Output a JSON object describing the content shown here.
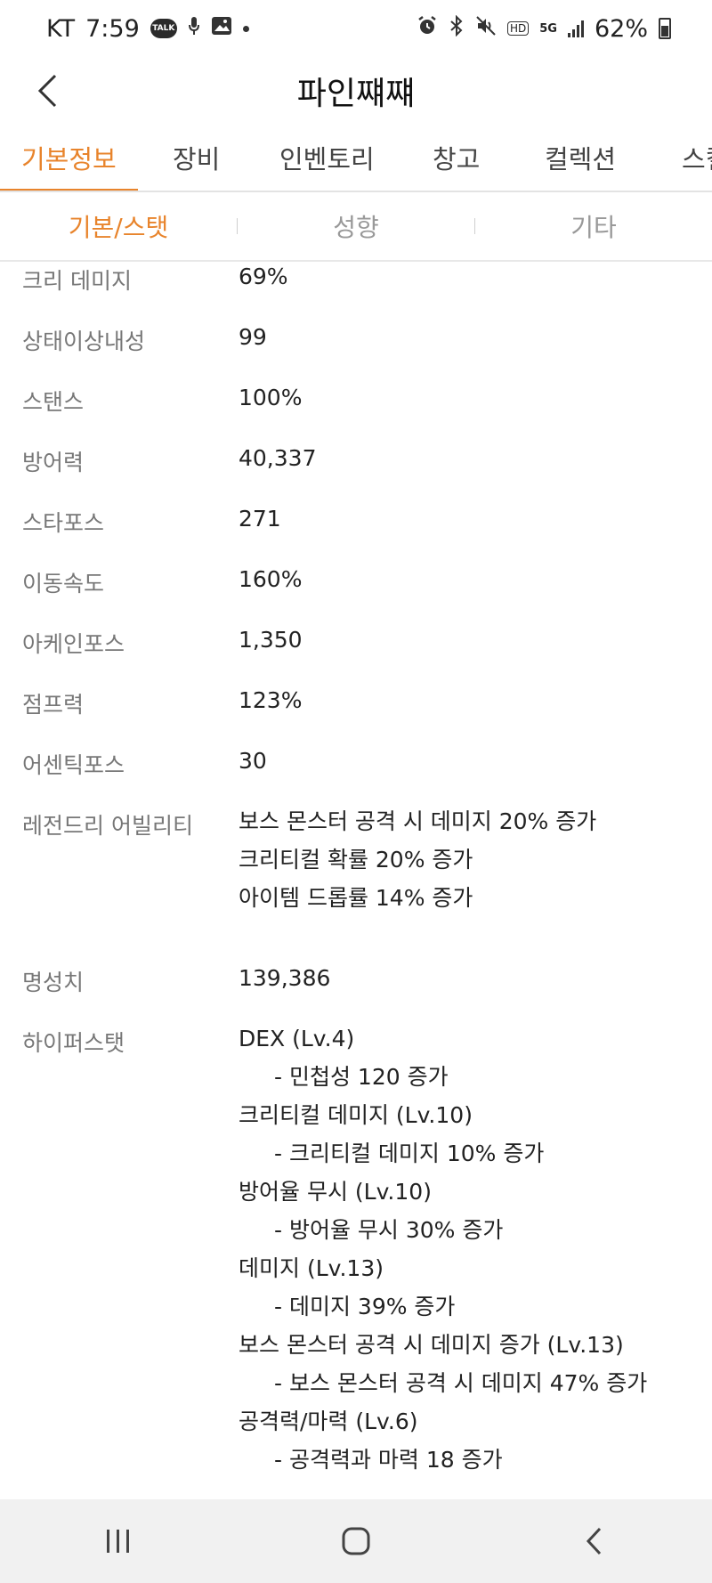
{
  "status_bar": {
    "carrier": "KT",
    "time": "7:59",
    "talk_badge": "TALK",
    "hd": "HD",
    "network": "5G",
    "battery_percent": "62%"
  },
  "header": {
    "title": "파인쨰쨰"
  },
  "tabs": [
    {
      "label": "기본정보",
      "active": true
    },
    {
      "label": "장비",
      "active": false
    },
    {
      "label": "인벤토리",
      "active": false
    },
    {
      "label": "창고",
      "active": false
    },
    {
      "label": "컬렉션",
      "active": false
    },
    {
      "label": "스킬",
      "active": false
    }
  ],
  "subtabs": [
    {
      "label": "기본/스탯",
      "active": true
    },
    {
      "label": "성향",
      "active": false
    },
    {
      "label": "기타",
      "active": false
    }
  ],
  "stats": [
    {
      "label": "크리 데미지",
      "value": "69%"
    },
    {
      "label": "상태이상내성",
      "value": "99"
    },
    {
      "label": "스탠스",
      "value": "100%"
    },
    {
      "label": "방어력",
      "value": "40,337"
    },
    {
      "label": "스타포스",
      "value": "271"
    },
    {
      "label": "이동속도",
      "value": "160%"
    },
    {
      "label": "아케인포스",
      "value": "1,350"
    },
    {
      "label": "점프력",
      "value": "123%"
    },
    {
      "label": "어센틱포스",
      "value": "30"
    }
  ],
  "legendary": {
    "label": "레전드리 어빌리티",
    "lines": [
      "보스 몬스터 공격 시 데미지 20% 증가",
      "크리티컬 확률 20% 증가",
      "아이템 드롭률 14% 증가"
    ]
  },
  "fame": {
    "label": "명성치",
    "value": "139,386"
  },
  "hyper_stat": {
    "label": "하이퍼스탯",
    "items": [
      {
        "title": "DEX (Lv.4)",
        "detail": "- 민첩성 120 증가"
      },
      {
        "title": "크리티컬 데미지 (Lv.10)",
        "detail": "- 크리티컬 데미지 10% 증가"
      },
      {
        "title": "방어율 무시 (Lv.10)",
        "detail": "- 방어율 무시 30% 증가"
      },
      {
        "title": "데미지 (Lv.13)",
        "detail": "- 데미지 39% 증가"
      },
      {
        "title": "보스 몬스터 공격 시 데미지 증가 (Lv.13)",
        "detail": "- 보스 몬스터 공격 시 데미지 47% 증가"
      },
      {
        "title": "공격력/마력 (Lv.6)",
        "detail": "- 공격력과 마력 18 증가"
      }
    ]
  },
  "colors": {
    "accent": "#e8842c",
    "label_gray": "#777777",
    "nav_bg": "#f1f1f1"
  }
}
